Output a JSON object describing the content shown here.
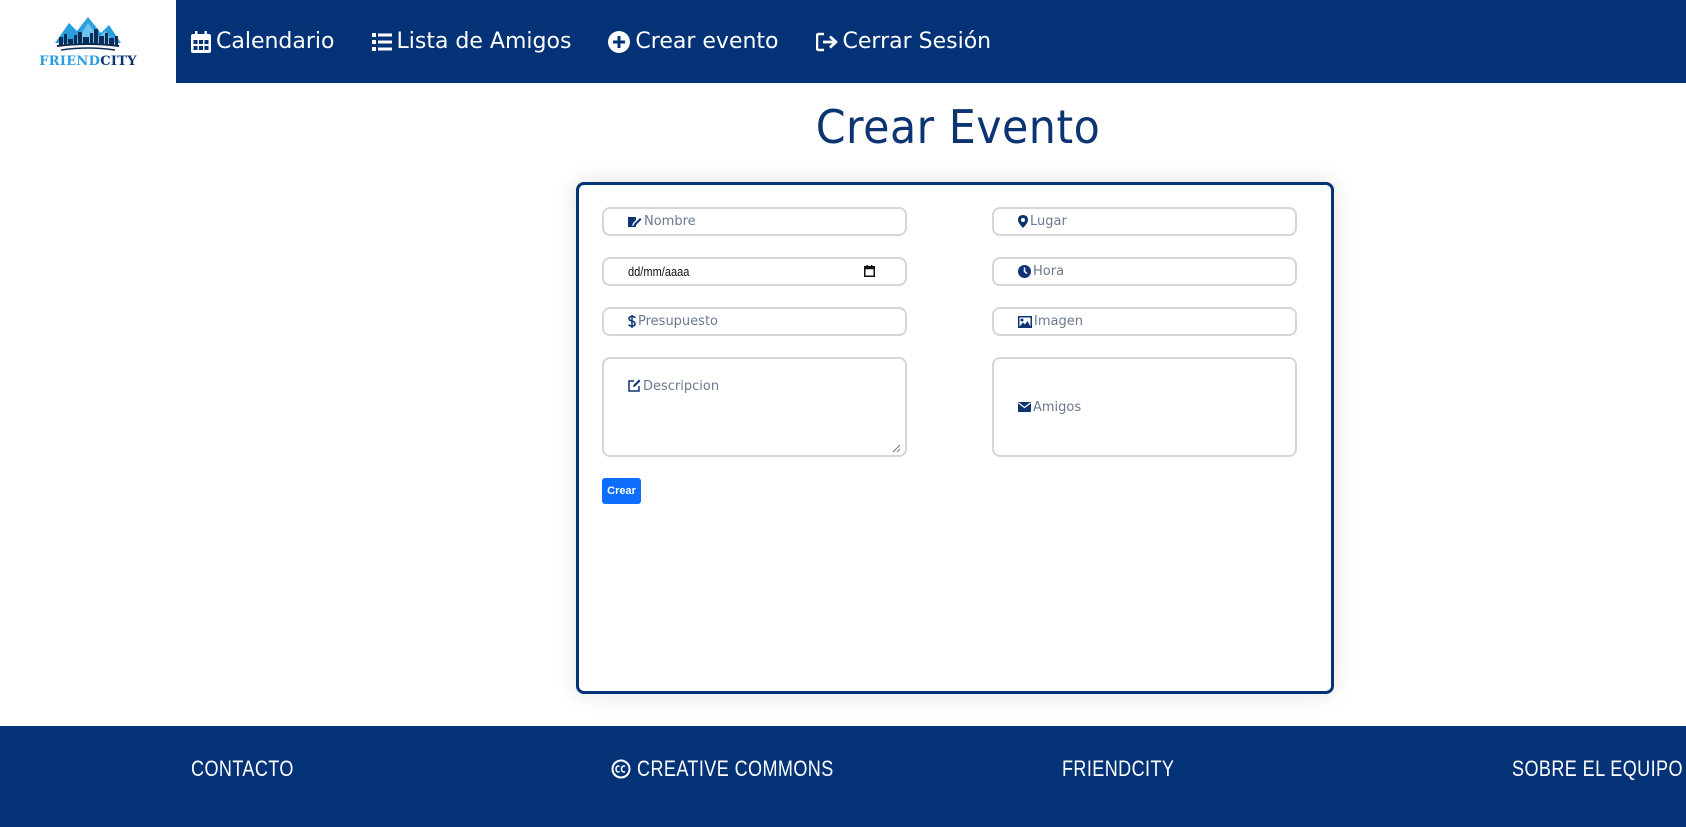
{
  "brand": {
    "part1": "FRIEND",
    "part2": "CITY"
  },
  "nav": {
    "calendar": "Calendario",
    "friends": "Lista de Amigos",
    "create": "Crear evento",
    "logout": "Cerrar Sesión"
  },
  "page": {
    "title": "Crear Evento"
  },
  "form": {
    "name_placeholder": "Nombre",
    "place_placeholder": "Lugar",
    "date_value": "dd/mm/aaaa",
    "time_placeholder": "Hora",
    "budget_placeholder": "Presupuesto",
    "image_placeholder": "Imagen",
    "description_placeholder": "Descripcion",
    "friends_placeholder": "Amigos",
    "submit_label": "Crear"
  },
  "footer": {
    "contact": "CONTACTO",
    "cc": "CREATIVE COMMONS",
    "brand": "FRIENDCITY",
    "team": "SOBRE EL EQUIPO"
  },
  "colors": {
    "primary": "#033276",
    "button": "#0d6efd",
    "brand_light": "#2a9fe0"
  }
}
